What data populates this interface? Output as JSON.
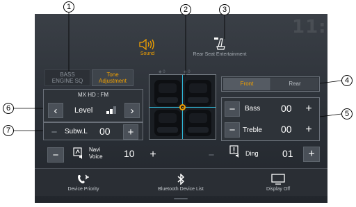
{
  "header": {
    "sound_tab": {
      "label": "Sound",
      "icon": "speaker-icon",
      "active": true
    },
    "rear_tab": {
      "label": "Rear Seat Entertainment",
      "icon": "rear-seat-icon"
    }
  },
  "mode_tabs": {
    "bass_engine": "BASS ENGINE SQ",
    "tone_adjustment": "Tone Adjustment"
  },
  "position_readout": {
    "left": "0",
    "right": "0"
  },
  "level": {
    "source": "MX HD : FM",
    "label": "Level",
    "meter_level": 2,
    "meter_max": 3
  },
  "subwoofer": {
    "label": "Subw.L",
    "value": "00"
  },
  "speaker_select": {
    "front": "Front",
    "rear": "Rear",
    "selected": "Front"
  },
  "tone": {
    "bass_label": "Bass",
    "bass_value": "00",
    "treble_label": "Treble",
    "treble_value": "00"
  },
  "navi_voice": {
    "label": "Navi Voice",
    "value": "10"
  },
  "ding": {
    "label": "Ding",
    "value": "01"
  },
  "bottom": {
    "device_priority": "Device Priority",
    "bluetooth_list": "Bluetooth Device List",
    "display_off": "Display Off"
  },
  "callouts": [
    "1",
    "2",
    "3",
    "4",
    "5",
    "6",
    "7"
  ],
  "colors": {
    "accent": "#f2a100",
    "cross": "#2fb7d7",
    "background": "#2b3037"
  }
}
